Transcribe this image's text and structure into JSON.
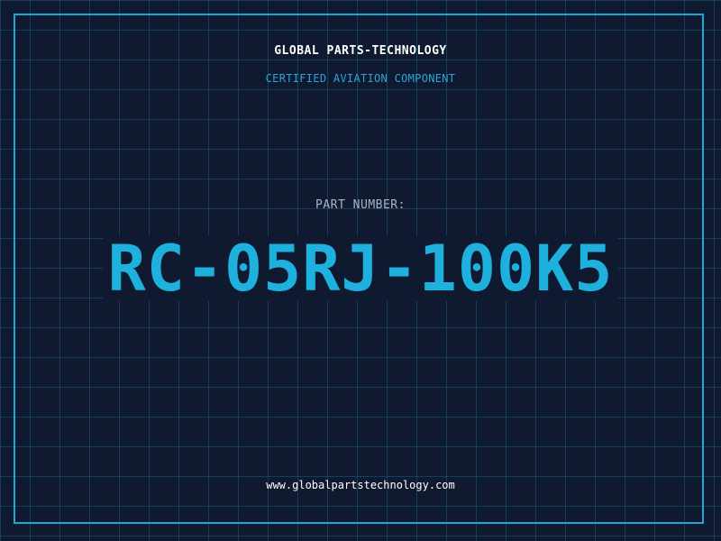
{
  "header": {
    "company": "GLOBAL PARTS-TECHNOLOGY",
    "tagline": "CERTIFIED AVIATION COMPONENT"
  },
  "main": {
    "label": "PART NUMBER:",
    "part_number": "RC-05RJ-100K5"
  },
  "footer": {
    "url": "www.globalpartstechnology.com"
  },
  "colors": {
    "background": "#0f1a30",
    "accent": "#1eb1de",
    "grid": "#208caa"
  }
}
